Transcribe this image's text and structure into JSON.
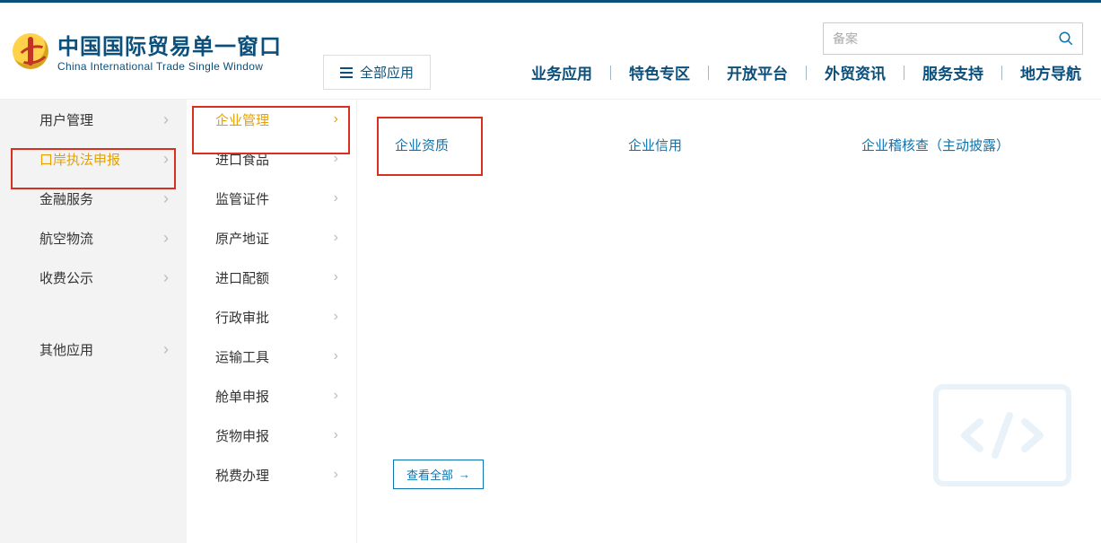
{
  "header": {
    "title_cn": "中国国际贸易单一窗口",
    "title_en": "China International Trade Single Window",
    "search_placeholder": "备案",
    "all_apps_label": "全部应用",
    "nav": [
      "业务应用",
      "特色专区",
      "开放平台",
      "外贸资讯",
      "服务支持",
      "地方导航"
    ]
  },
  "sidebar1": {
    "group1": [
      {
        "label": "用户管理"
      },
      {
        "label": "口岸执法申报",
        "active": true
      },
      {
        "label": "金融服务"
      },
      {
        "label": "航空物流"
      },
      {
        "label": "收费公示"
      }
    ],
    "group2": [
      {
        "label": "其他应用"
      }
    ]
  },
  "sidebar2": [
    {
      "label": "企业管理",
      "active": true
    },
    {
      "label": "进口食品"
    },
    {
      "label": "监管证件"
    },
    {
      "label": "原产地证"
    },
    {
      "label": "进口配额"
    },
    {
      "label": "行政审批"
    },
    {
      "label": "运输工具"
    },
    {
      "label": "舱单申报"
    },
    {
      "label": "货物申报"
    },
    {
      "label": "税费办理"
    }
  ],
  "content": {
    "items": [
      "企业资质",
      "企业信用",
      "企业稽核查（主动披露）"
    ],
    "view_all_label": "查看全部"
  }
}
